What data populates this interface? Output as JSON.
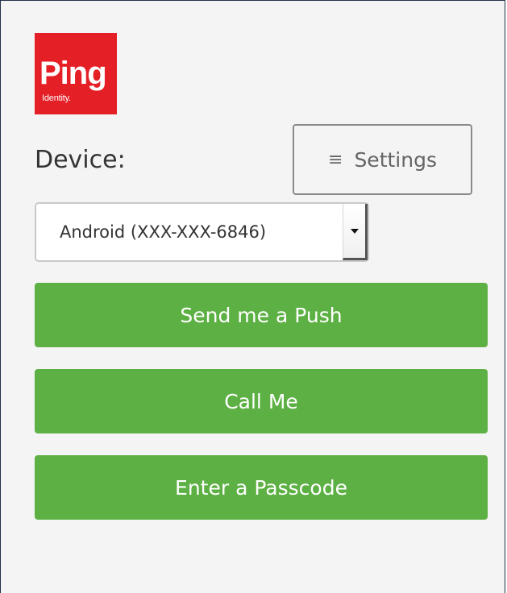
{
  "brand": {
    "logo_word": "Ping",
    "logo_sub": "Identity.",
    "logo_color": "#e41f26"
  },
  "device": {
    "label": "Device:",
    "selected": "Android (XXX-XXX-6846)"
  },
  "settings": {
    "icon": "menu-icon",
    "label": "Settings"
  },
  "actions": [
    {
      "label": "Send me a Push"
    },
    {
      "label": "Call Me"
    },
    {
      "label": "Enter a Passcode"
    }
  ],
  "colors": {
    "action_button": "#5db043",
    "background": "#f4f4f4"
  }
}
